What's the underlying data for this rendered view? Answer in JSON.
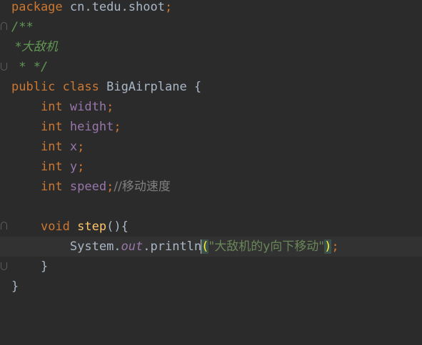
{
  "code": {
    "l1": {
      "kw": "package",
      "rest": " cn.tedu.shoot",
      "semi": ";"
    },
    "l2": {
      "text": "/**"
    },
    "l3": {
      "text": " *大敌机"
    },
    "l4": {
      "text": " * */"
    },
    "l5": {
      "kw1": "public",
      "kw2": "class",
      "name": " BigAirplane {"
    },
    "l6": {
      "type": "int",
      "name": "width",
      "semi": ";"
    },
    "l7": {
      "type": "int",
      "name": "height",
      "semi": ";"
    },
    "l8": {
      "type": "int",
      "name": "x",
      "semi": ";"
    },
    "l9": {
      "type": "int",
      "name": "y",
      "semi": ";"
    },
    "l10": {
      "type": "int",
      "name": "speed",
      "semi": ";",
      "comment": "//移动速度"
    },
    "l12": {
      "kw": "void",
      "method": "step",
      "rest": "(){"
    },
    "l13": {
      "cls": "System.",
      "field": "out",
      "dot": ".println",
      "lparen": "(",
      "str": "\"大敌机的y向下移动\"",
      "rparen": ")",
      "semi": ";"
    },
    "l14": {
      "text": "}"
    },
    "l15": {
      "text": "}"
    }
  }
}
